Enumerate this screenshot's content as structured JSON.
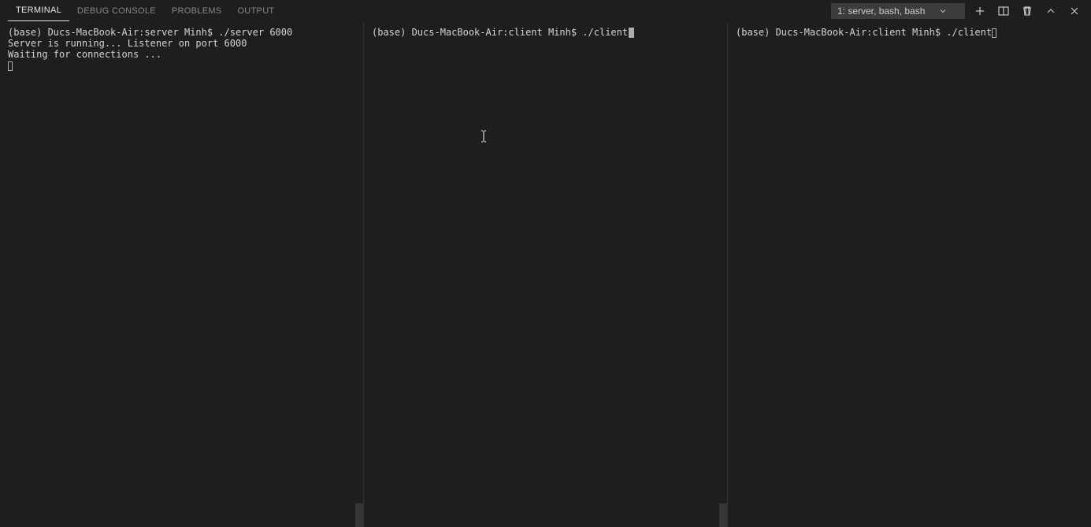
{
  "tabs": {
    "terminal": "TERMINAL",
    "debug_console": "DEBUG CONSOLE",
    "problems": "PROBLEMS",
    "output": "OUTPUT"
  },
  "terminal_select": "1: server, bash, bash",
  "panes": {
    "pane1": {
      "line1": "(base) Ducs-MacBook-Air:server Minh$ ./server 6000",
      "line2": "Server is running... Listener on port 6000",
      "line3": "Waiting for connections ..."
    },
    "pane2": {
      "line1": "(base) Ducs-MacBook-Air:client Minh$ ./client"
    },
    "pane3": {
      "line1": "(base) Ducs-MacBook-Air:client Minh$ ./client"
    }
  }
}
